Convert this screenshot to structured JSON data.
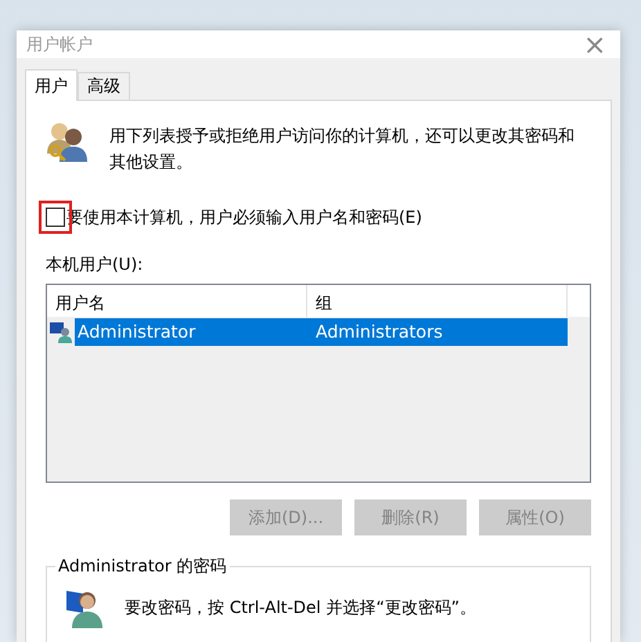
{
  "window": {
    "title": "用户帐户",
    "close": "×"
  },
  "tabs": [
    {
      "label": "用户",
      "selected": true
    },
    {
      "label": "高级",
      "selected": false
    }
  ],
  "description": "用下列表授予或拒绝用户访问你的计算机，还可以更改其密码和其他设置。",
  "require_login": {
    "label": "要使用本计算机，用户必须输入用户名和密码(E)",
    "checked": false,
    "highlighted": true
  },
  "users_label": "本机用户(U):",
  "table": {
    "columns": [
      "用户名",
      "组"
    ],
    "rows": [
      {
        "cells": [
          "Administrator",
          "Administrators"
        ],
        "selected": true
      }
    ]
  },
  "buttons": [
    {
      "label": "添加(D)...",
      "disabled": true
    },
    {
      "label": "删除(R)",
      "disabled": true
    },
    {
      "label": "属性(O)",
      "disabled": true
    }
  ],
  "password_group": {
    "title": "Administrator 的密码",
    "text": "要改密码，按 Ctrl-Alt-Del 并选择“更改密码”。"
  }
}
